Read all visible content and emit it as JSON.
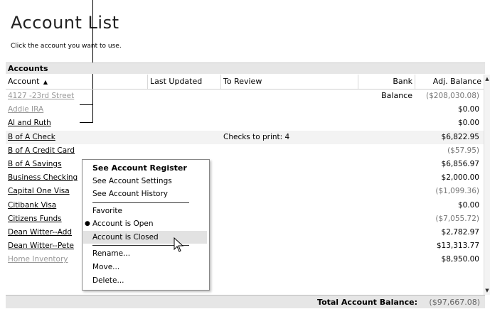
{
  "page": {
    "title": "Account List",
    "subtitle": "Click the account you want to use."
  },
  "section_label": "Accounts",
  "columns": {
    "account": "Account",
    "last_updated": "Last Updated",
    "to_review": "To Review",
    "bank_balance": "Bank Balance",
    "adj_balance": "Adj. Balance"
  },
  "rows": [
    {
      "account": "4127 -23rd Street",
      "to_review": "",
      "adj_balance": "($208,030.08)"
    },
    {
      "account": "Addie IRA",
      "to_review": "",
      "adj_balance": "$0.00"
    },
    {
      "account": "Al and Ruth",
      "to_review": "",
      "adj_balance": "$0.00"
    },
    {
      "account": "B of A Check",
      "to_review": "Checks to print: 4",
      "adj_balance": "$6,822.95"
    },
    {
      "account": "B of A Credit Card",
      "to_review": "",
      "adj_balance": "($57.95)"
    },
    {
      "account": "B of A Savings",
      "to_review": "",
      "adj_balance": "$6,856.97"
    },
    {
      "account": "Business Checking",
      "to_review": "",
      "adj_balance": "$2,000.00"
    },
    {
      "account": "Capital One Visa",
      "to_review": "",
      "adj_balance": "($1,099.36)"
    },
    {
      "account": "Citibank Visa",
      "to_review": "",
      "adj_balance": "$0.00"
    },
    {
      "account": "Citizens Funds",
      "to_review": "",
      "adj_balance": "($7,055.72)"
    },
    {
      "account": "Dean Witter--Add",
      "to_review": "",
      "adj_balance": "$2,782.97"
    },
    {
      "account": "Dean Witter--Pete",
      "to_review": "",
      "adj_balance": "$13,313.77"
    },
    {
      "account": "Home Inventory",
      "to_review": "",
      "adj_balance": "$8,950.00"
    }
  ],
  "total": {
    "label": "Total Account Balance:",
    "value": "($97,667.08)"
  },
  "context_menu": {
    "see_register": "See Account Register",
    "see_settings": "See Account Settings",
    "see_history": "See Account History",
    "favorite": "Favorite",
    "account_open": "Account is Open",
    "account_closed": "Account is Closed",
    "rename": "Rename...",
    "move": "Move...",
    "delete": "Delete..."
  },
  "icons": {
    "sort": "sort-ascending-icon",
    "bullet": "radio-bullet-icon",
    "cursor": "mouse-pointer-icon"
  }
}
